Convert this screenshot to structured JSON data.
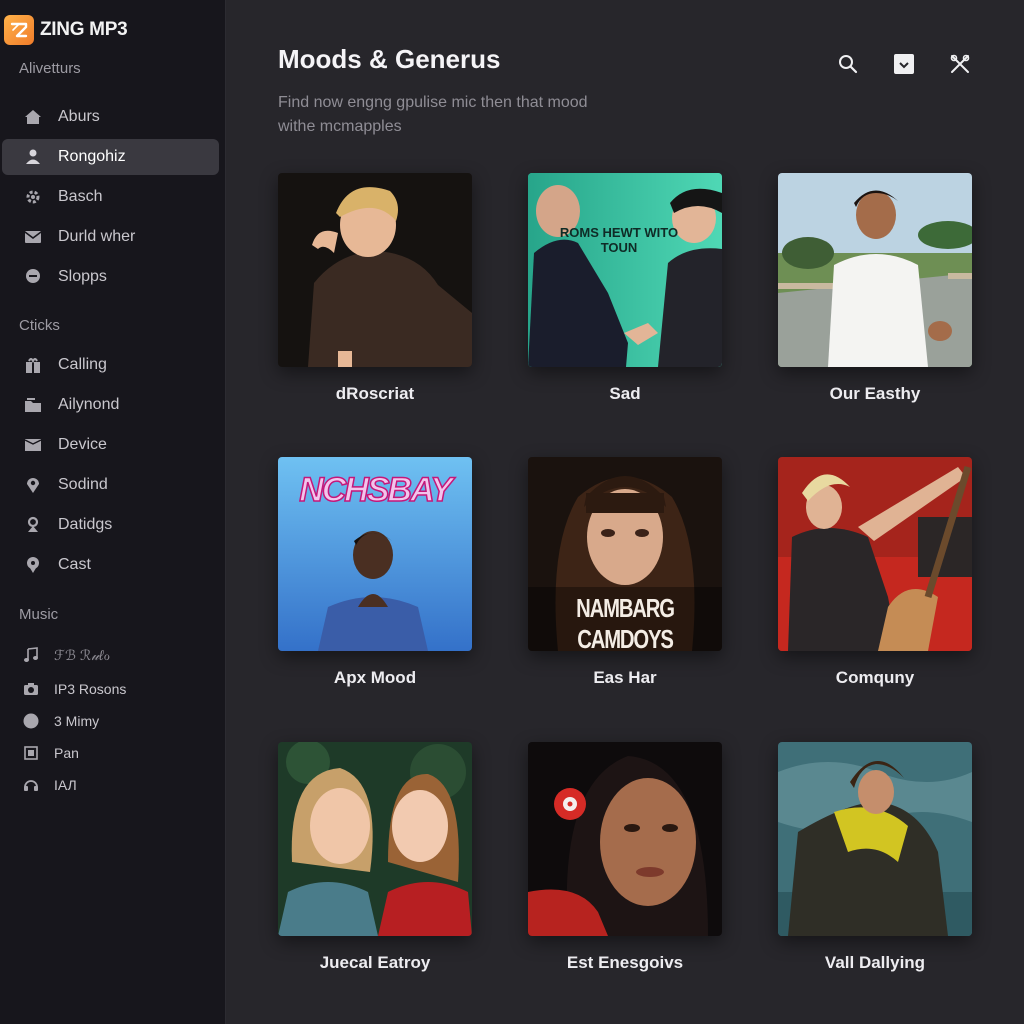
{
  "app": {
    "name": "ZING MP3"
  },
  "sidebar": {
    "section1": "Alivetturs",
    "items1": [
      {
        "label": "Aburs",
        "icon": "home-icon"
      },
      {
        "label": "Rongohiz",
        "icon": "person-icon"
      },
      {
        "label": "Basch",
        "icon": "gear-icon"
      },
      {
        "label": "Durld wher",
        "icon": "mail-icon"
      },
      {
        "label": "Slopрs",
        "icon": "chat-icon"
      }
    ],
    "section2": "Cticks",
    "items2": [
      {
        "label": "Calling",
        "icon": "gift-icon"
      },
      {
        "label": "Ailynond",
        "icon": "folder-icon"
      },
      {
        "label": "Device",
        "icon": "envelope-icon"
      },
      {
        "label": "Sodind",
        "icon": "location-pin-icon"
      },
      {
        "label": "Datidgs",
        "icon": "user-pin-icon"
      },
      {
        "label": "Cast",
        "icon": "pin-icon"
      }
    ],
    "section3": "Music",
    "items3": [
      {
        "label": "ℱℬ ℛ𝓊ℓℴ",
        "icon": "music-note-icon"
      },
      {
        "label": "IP3 Rosons",
        "icon": "camera-icon"
      },
      {
        "label": "3 Mimy",
        "icon": "circle-icon"
      },
      {
        "label": "Pan",
        "icon": "grid-icon"
      },
      {
        "label": "ІАЛ",
        "icon": "headset-icon"
      }
    ]
  },
  "main": {
    "title": "Moods & Generus",
    "subtitle_line1": "Find now engng gpulise mic then that mood",
    "subtitle_line2": "withe mcmapples",
    "cards": [
      {
        "caption": "dRoscriat",
        "art_text": ""
      },
      {
        "caption": "Sad",
        "art_text": "ROMS HEWT WITO TOUN"
      },
      {
        "caption": "Our Easthy",
        "art_text": ""
      },
      {
        "caption": "Apx Mood",
        "art_text": "NCHSBAY"
      },
      {
        "caption": "Eas Har",
        "art_text": "NAMBARG CAMDOYS"
      },
      {
        "caption": "Comquny",
        "art_text": ""
      },
      {
        "caption": "Juecal Eatroy",
        "art_text": ""
      },
      {
        "caption": "Est Enesgoivs",
        "art_text": ""
      },
      {
        "caption": "Vall Dallying",
        "art_text": ""
      }
    ]
  },
  "colors": {
    "sidebar_bg": "#17161c",
    "main_bg": "#27262b",
    "active_item_bg": "#3a3940",
    "logo_accent": "#f59a36"
  }
}
